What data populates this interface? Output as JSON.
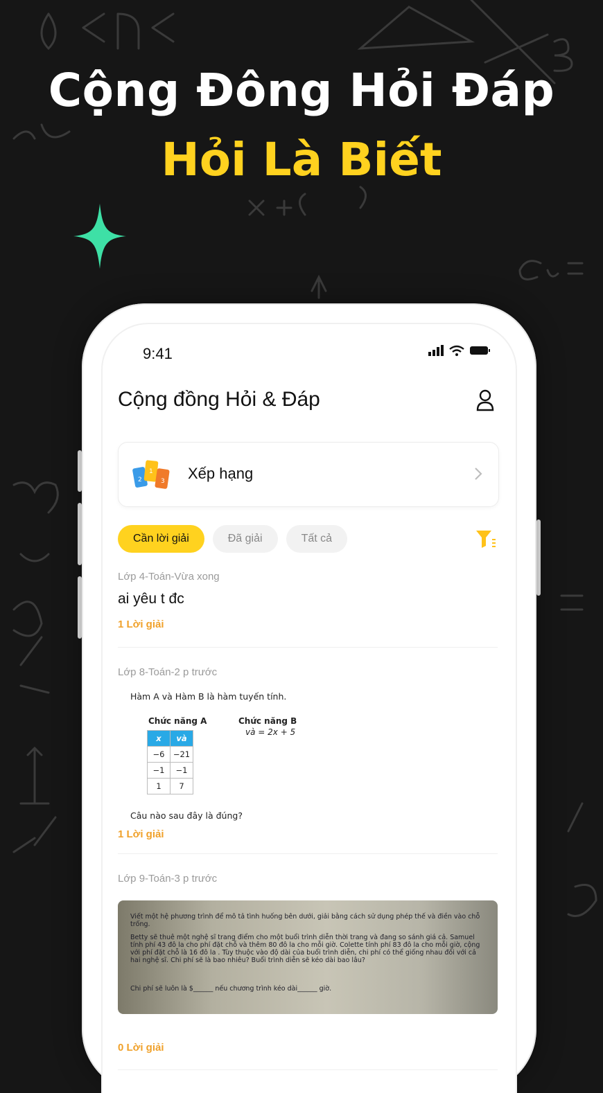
{
  "hero": {
    "line1": "Cộng Đông Hỏi Đáp",
    "line2": "Hỏi Là Biết"
  },
  "colors": {
    "accent": "#FFD21F",
    "answer": "#F0A12A",
    "sparkle": "#3EE0A6",
    "table_header": "#29A9E6"
  },
  "status_bar": {
    "time": "9:41"
  },
  "app": {
    "title": "Cộng đồng Hỏi & Đáp",
    "ranking_label": "Xếp hạng",
    "tabs": [
      "Cần lời giải",
      "Đã giải",
      "Tất cả"
    ],
    "active_tab": "Cần lời giải"
  },
  "posts": [
    {
      "meta": "Lớp 4-Toán-Vừa xong",
      "text": "ai yêu t đc",
      "answers": "1 Lời giải"
    },
    {
      "meta": "Lớp 8-Toán-2 p trước",
      "image": {
        "intro": "Hàm A và Hàm B là hàm tuyến tính.",
        "function_a_title": "Chức năng A",
        "function_b_title": "Chức năng B",
        "function_b_equation": "và = 2x + 5",
        "table_headers": [
          "x",
          "và"
        ],
        "table_rows": [
          [
            "−6",
            "−21"
          ],
          [
            "−1",
            "−1"
          ],
          [
            "1",
            "7"
          ]
        ],
        "question": "Câu nào sau đây là đúng?"
      },
      "answers": "1 Lời giải"
    },
    {
      "meta": "Lớp 9-Toán-3 p trước",
      "photo_text": {
        "p1": "Viết một hệ phương trình để mô tả tình huống bên dưới, giải bằng cách sử dụng phép thế và điền vào chỗ trống.",
        "p2": "Betty sẽ thuê một nghệ sĩ trang điểm cho một buổi trình diễn thời trang và đang so sánh giá cả. Samuel tính phí 43 đô la cho phí đặt chỗ và thêm 80 đô la cho mỗi giờ. Colette tính phí 83 đô la cho mỗi giờ, cộng với phí đặt chỗ là 16 đô la . Tùy thuộc vào độ dài của buổi trình diễn, chi phí có thể giống nhau đối với cả hai nghệ sĩ. Chi phí sẽ là bao nhiêu? Buổi trình diễn sẽ kéo dài bao lâu?",
        "p3": "Chi phí sẽ luôn là $______ nếu chương trình kéo dài______ giờ."
      },
      "answers": "0 Lời giải"
    }
  ]
}
